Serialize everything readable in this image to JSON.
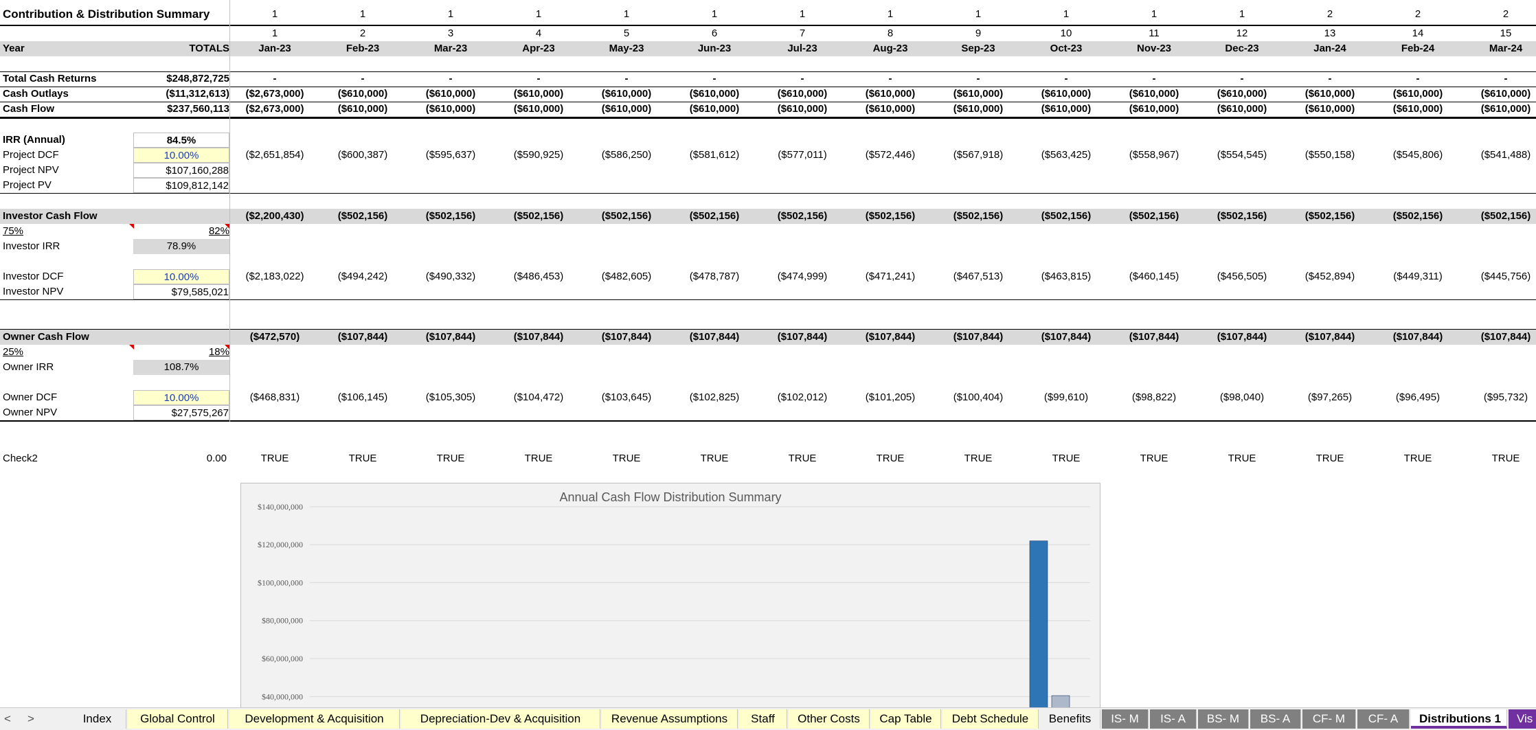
{
  "sheet": {
    "title": "Contribution & Distribution Summary",
    "year_row": [
      "1",
      "1",
      "1",
      "1",
      "1",
      "1",
      "1",
      "1",
      "1",
      "1",
      "1",
      "1",
      "2",
      "2",
      "2"
    ],
    "period_row": [
      "1",
      "2",
      "3",
      "4",
      "5",
      "6",
      "7",
      "8",
      "9",
      "10",
      "11",
      "12",
      "13",
      "14",
      "15"
    ],
    "month_row": [
      "Jan-23",
      "Feb-23",
      "Mar-23",
      "Apr-23",
      "May-23",
      "Jun-23",
      "Jul-23",
      "Aug-23",
      "Sep-23",
      "Oct-23",
      "Nov-23",
      "Dec-23",
      "Jan-24",
      "Feb-24",
      "Mar-24"
    ],
    "year_label": "Year",
    "totals_label": "TOTALS"
  },
  "cash": {
    "returns": {
      "label": "Total Cash Returns",
      "total": "$248,872,725",
      "values": [
        "-",
        "-",
        "-",
        "-",
        "-",
        "-",
        "-",
        "-",
        "-",
        "-",
        "-",
        "-",
        "-",
        "-",
        "-"
      ]
    },
    "outlays": {
      "label": "Cash Outlays",
      "total": "($11,312,613)",
      "values": [
        "($2,673,000)",
        "($610,000)",
        "($610,000)",
        "($610,000)",
        "($610,000)",
        "($610,000)",
        "($610,000)",
        "($610,000)",
        "($610,000)",
        "($610,000)",
        "($610,000)",
        "($610,000)",
        "($610,000)",
        "($610,000)",
        "($610,000)"
      ]
    },
    "flow": {
      "label": "Cash Flow",
      "total": "$237,560,113",
      "values": [
        "($2,673,000)",
        "($610,000)",
        "($610,000)",
        "($610,000)",
        "($610,000)",
        "($610,000)",
        "($610,000)",
        "($610,000)",
        "($610,000)",
        "($610,000)",
        "($610,000)",
        "($610,000)",
        "($610,000)",
        "($610,000)",
        "($610,000)"
      ]
    }
  },
  "project": {
    "irr_label": "IRR (Annual)",
    "irr": "84.5%",
    "dcf_label": "Project DCF",
    "dcf": "10.00%",
    "dcf_values": [
      "($2,651,854)",
      "($600,387)",
      "($595,637)",
      "($590,925)",
      "($586,250)",
      "($581,612)",
      "($577,011)",
      "($572,446)",
      "($567,918)",
      "($563,425)",
      "($558,967)",
      "($554,545)",
      "($550,158)",
      "($545,806)",
      "($541,488)"
    ],
    "npv_label": "Project NPV",
    "npv": "$107,160,288",
    "pv_label": "Project PV",
    "pv": "$109,812,142"
  },
  "investor": {
    "label": "Investor Cash Flow",
    "values": [
      "($2,200,430)",
      "($502,156)",
      "($502,156)",
      "($502,156)",
      "($502,156)",
      "($502,156)",
      "($502,156)",
      "($502,156)",
      "($502,156)",
      "($502,156)",
      "($502,156)",
      "($502,156)",
      "($502,156)",
      "($502,156)",
      "($502,156)"
    ],
    "share_left": "75%",
    "share_right": "82%",
    "irr_label": "Investor IRR",
    "irr": "78.9%",
    "dcf_label": "Investor DCF",
    "dcf": "10.00%",
    "dcf_values": [
      "($2,183,022)",
      "($494,242)",
      "($490,332)",
      "($486,453)",
      "($482,605)",
      "($478,787)",
      "($474,999)",
      "($471,241)",
      "($467,513)",
      "($463,815)",
      "($460,145)",
      "($456,505)",
      "($452,894)",
      "($449,311)",
      "($445,756)"
    ],
    "npv_label": "Investor NPV",
    "npv": "$79,585,021"
  },
  "owner": {
    "label": "Owner Cash Flow",
    "values": [
      "($472,570)",
      "($107,844)",
      "($107,844)",
      "($107,844)",
      "($107,844)",
      "($107,844)",
      "($107,844)",
      "($107,844)",
      "($107,844)",
      "($107,844)",
      "($107,844)",
      "($107,844)",
      "($107,844)",
      "($107,844)",
      "($107,844)"
    ],
    "share_left": "25%",
    "share_right": "18%",
    "irr_label": "Owner IRR",
    "irr": "108.7%",
    "dcf_label": "Owner DCF",
    "dcf": "10.00%",
    "dcf_values": [
      "($468,831)",
      "($106,145)",
      "($105,305)",
      "($104,472)",
      "($103,645)",
      "($102,825)",
      "($102,012)",
      "($101,205)",
      "($100,404)",
      "($99,610)",
      "($98,822)",
      "($98,040)",
      "($97,265)",
      "($96,495)",
      "($95,732)"
    ],
    "npv_label": "Owner NPV",
    "npv": "$27,575,267"
  },
  "check": {
    "label": "Check2",
    "total": "0.00",
    "values": [
      "TRUE",
      "TRUE",
      "TRUE",
      "TRUE",
      "TRUE",
      "TRUE",
      "TRUE",
      "TRUE",
      "TRUE",
      "TRUE",
      "TRUE",
      "TRUE",
      "TRUE",
      "TRUE",
      "TRUE"
    ]
  },
  "chart_data": {
    "type": "bar",
    "title": "Annual Cash Flow Distribution Summary",
    "ylim": [
      30000000,
      145000000
    ],
    "y_ticks": [
      "$140,000,000",
      "$120,000,000",
      "$100,000,000",
      "$80,000,000",
      "$60,000,000",
      "$40,000,000"
    ],
    "y_tick_values": [
      140000000,
      120000000,
      100000000,
      80000000,
      60000000,
      40000000
    ],
    "grid": true,
    "bars": [
      {
        "value": 122000000,
        "color": "#2e75b6"
      },
      {
        "value": 40500000,
        "color": "#adb9ca"
      }
    ]
  },
  "tabs": {
    "nav_prev": "<",
    "nav_next": ">",
    "items": [
      {
        "label": "Index",
        "style": "plain"
      },
      {
        "label": "Global Control",
        "style": "yellow"
      },
      {
        "label": "Development & Acquisition",
        "style": "yellow"
      },
      {
        "label": "Depreciation-Dev & Acquisition",
        "style": "yellow"
      },
      {
        "label": "Revenue Assumptions",
        "style": "yellow"
      },
      {
        "label": "Staff",
        "style": "yellow"
      },
      {
        "label": "Other Costs",
        "style": "yellow"
      },
      {
        "label": "Cap Table",
        "style": "yellow"
      },
      {
        "label": "Debt Schedule",
        "style": "yellow"
      },
      {
        "label": "Benefits",
        "style": "plain"
      },
      {
        "label": "IS- M",
        "style": "grey"
      },
      {
        "label": "IS- A",
        "style": "grey"
      },
      {
        "label": "BS- M",
        "style": "grey"
      },
      {
        "label": "BS- A",
        "style": "grey"
      },
      {
        "label": "CF- M",
        "style": "grey"
      },
      {
        "label": "CF- A",
        "style": "grey"
      },
      {
        "label": "Distributions 1",
        "style": "active"
      },
      {
        "label": "Vis",
        "style": "purple"
      }
    ]
  }
}
